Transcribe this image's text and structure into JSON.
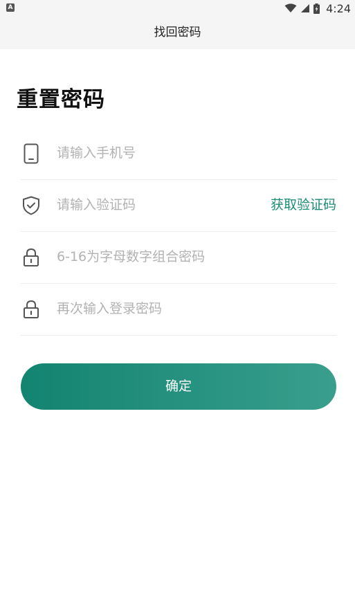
{
  "status_bar": {
    "app_icon_letter": "A",
    "time": "4:24"
  },
  "nav": {
    "title": "找回密码"
  },
  "heading": "重置密码",
  "form": {
    "phone": {
      "placeholder": "请输入手机号",
      "value": "",
      "icon": "phone-icon"
    },
    "code": {
      "placeholder": "请输入验证码",
      "value": "",
      "icon": "shield-check-icon",
      "get_code_label": "获取验证码"
    },
    "password": {
      "placeholder": "6-16为字母数字组合密码",
      "value": "",
      "icon": "lock-icon"
    },
    "confirm_password": {
      "placeholder": "再次输入登录密码",
      "value": "",
      "icon": "lock-icon"
    }
  },
  "confirm_button_label": "确定",
  "colors": {
    "accent": "#1d8b75",
    "button_gradient_start": "#128470",
    "button_gradient_end": "#3a9e8d",
    "placeholder": "#b2b2b2",
    "divider": "#ececec"
  }
}
